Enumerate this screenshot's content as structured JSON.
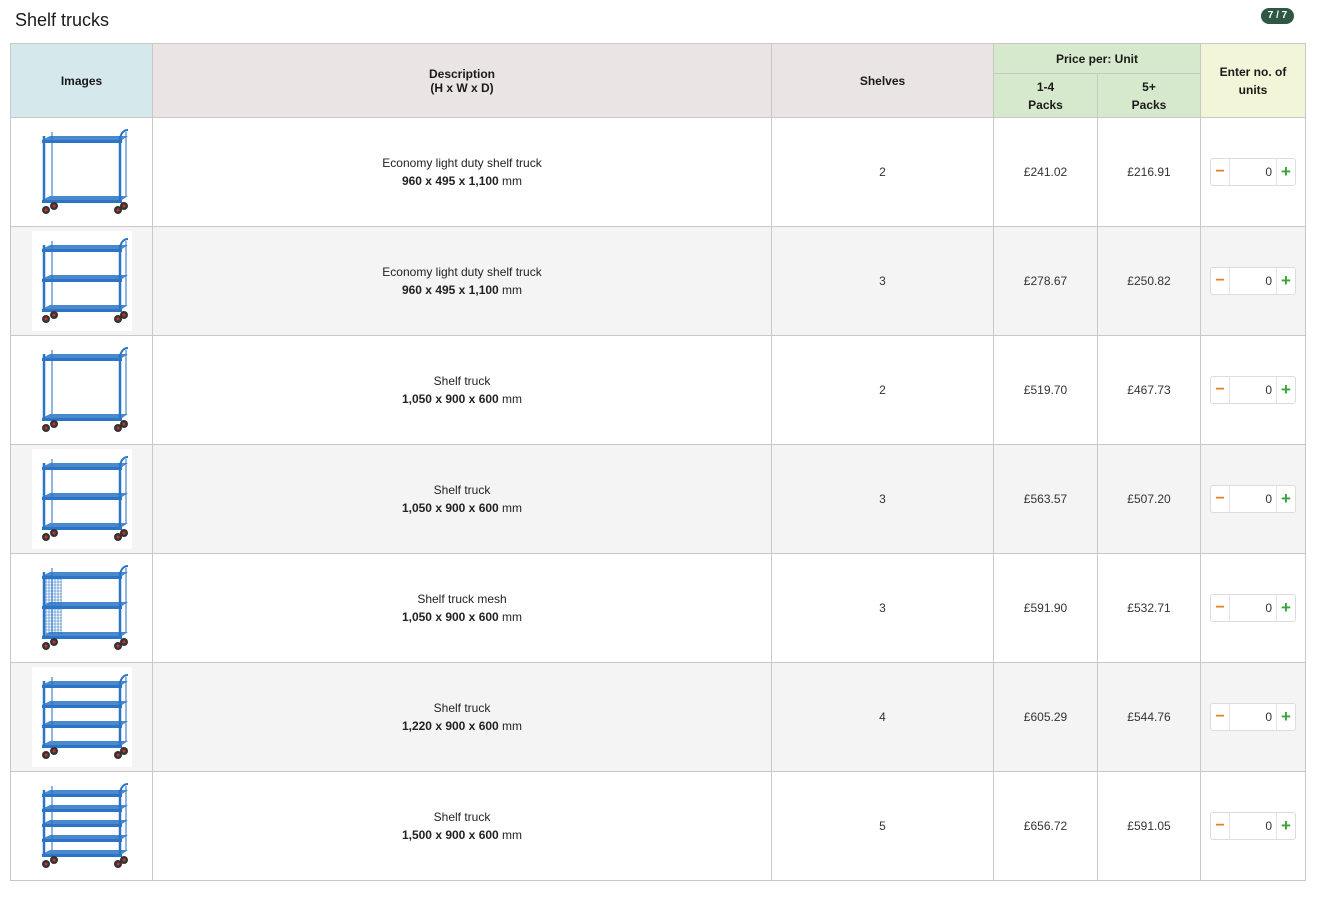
{
  "page": {
    "title": "Shelf trucks",
    "badge": "7 / 7"
  },
  "header": {
    "images": "Images",
    "description": "Description",
    "description_sub": "(H x W x D)",
    "shelves": "Shelves",
    "price_per": "Price per:  Unit",
    "pack1_a": "1-4",
    "pack1_b": "Packs",
    "pack2_a": "5+",
    "pack2_b": "Packs",
    "units_a": "Enter no. of",
    "units_b": "units"
  },
  "colors": {
    "header_images": "#d5e8ec",
    "header_desc": "#ebe4e4",
    "header_price": "#d7e9cc",
    "header_units": "#f2f5d8",
    "badge": "#2e5744",
    "minus": "#e67e22",
    "plus": "#3aa33a",
    "truck_blue": "#2b74c6"
  },
  "icons": {
    "minus": "minus-icon",
    "plus": "plus-icon"
  },
  "rows": [
    {
      "name": "Economy light duty shelf truck",
      "dims_num": "960 x 495 x 1,100",
      "dims_unit": " mm",
      "shelves": "2",
      "price_1_4": "£241.02",
      "price_5plus": "£216.91",
      "qty": "0",
      "shelf_count": 2
    },
    {
      "name": "Economy light duty shelf truck",
      "dims_num": "960 x 495 x 1,100",
      "dims_unit": " mm",
      "shelves": "3",
      "price_1_4": "£278.67",
      "price_5plus": "£250.82",
      "qty": "0",
      "shelf_count": 3
    },
    {
      "name": "Shelf truck",
      "dims_num": "1,050 x 900 x 600",
      "dims_unit": " mm",
      "shelves": "2",
      "price_1_4": "£519.70",
      "price_5plus": "£467.73",
      "qty": "0",
      "shelf_count": 2
    },
    {
      "name": "Shelf truck",
      "dims_num": "1,050 x 900 x 600",
      "dims_unit": " mm",
      "shelves": "3",
      "price_1_4": "£563.57",
      "price_5plus": "£507.20",
      "qty": "0",
      "shelf_count": 3
    },
    {
      "name": "Shelf truck mesh",
      "dims_num": "1,050 x 900 x 600",
      "dims_unit": " mm",
      "shelves": "3",
      "price_1_4": "£591.90",
      "price_5plus": "£532.71",
      "qty": "0",
      "shelf_count": 3
    },
    {
      "name": "Shelf truck",
      "dims_num": "1,220 x 900 x 600",
      "dims_unit": " mm",
      "shelves": "4",
      "price_1_4": "£605.29",
      "price_5plus": "£544.76",
      "qty": "0",
      "shelf_count": 4
    },
    {
      "name": "Shelf truck",
      "dims_num": "1,500 x 900 x 600",
      "dims_unit": " mm",
      "shelves": "5",
      "price_1_4": "£656.72",
      "price_5plus": "£591.05",
      "qty": "0",
      "shelf_count": 5
    }
  ]
}
